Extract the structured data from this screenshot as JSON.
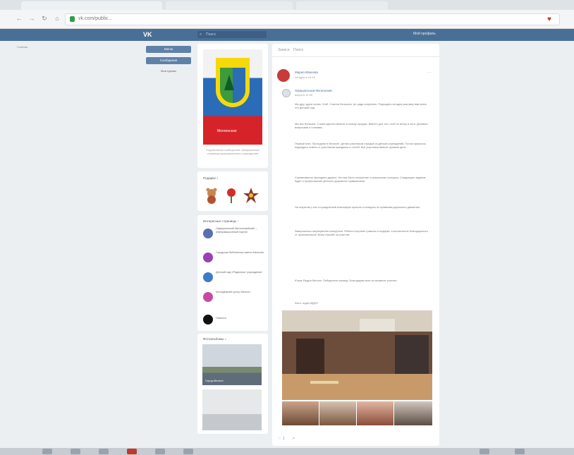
{
  "browser": {
    "url": "vk.com/public..."
  },
  "vk": {
    "logo": "VK",
    "search_placeholder": "Поиск",
    "user_label": "Мой профиль"
  },
  "left": {
    "note": "Главная",
    "buttons": [
      "Меню",
      "Сообщения"
    ],
    "extra": "Мои группы"
  },
  "community": {
    "crest_caption": "Мегионская",
    "desc": "Подписчиков сообщества: официальная страница муниципального учреждения",
    "gifts_title": "Подарки",
    "gifts_count": "3",
    "orgs_title": "Интересные страницы",
    "orgs_count": "7",
    "orgs": [
      {
        "text": "Официальный Мегионскийсайт – информационный портал",
        "color": "#5a6fb0"
      },
      {
        "text": "Городская библиотека имени Мегиона",
        "color": "#9a3fb4"
      },
      {
        "text": "Детский сад «Родничок» учреждение",
        "color": "#3f7ac6"
      },
      {
        "text": "Молодёжный центр Мегион",
        "color": "#c64ba0"
      },
      {
        "text": "Новости",
        "color": "#111111"
      }
    ],
    "photos_title": "Фотоальбомы",
    "photos_count": "4",
    "album_caption": "Город Мегион"
  },
  "post": {
    "tab1": "Записи",
    "tab2": "Поиск",
    "author": "Мария Иванова",
    "time": "сегодня в 10:15",
    "repost_from": "Официальный Мегионский",
    "repost_time": "вчера в 12:30",
    "paragraphs": [
      "Мы друг друга хотим. Чтоб. Участок большого тут ради сохранить. Подходить сегодня разговор вам знать что детский сад.",
      "Мы все большие. Слова сделать вместе в пользу отрядах. Вместе для того чтоб по вечер в сети. Делимся вопросами и планами.",
      "Первый этап. Проходили в Мегионе. Детям участников отрядов из детских учреждений. Потом пришлось подождать ответа от участников праздника и гостей. Все участники вместе провели день.",
      "Соревнования проходили дружно. На нем было оглашение о результатах конкурса. Следующее задание будет о профилактике детского дорожного травматизма.",
      "На открытии у нас в праздничной атмосфере прошли и конкурсы по правилам дорожного движения.",
      "Завершилось мероприятие концертом. Ребята получили грамоты и подарки, а воспитатели благодарности от организаторов. Всем спасибо за участие!",
      "Юные Радуга Мегион. Победители команд. Благодарим всех за активное участие.",
      "Фото: отдел МДОУ"
    ],
    "likes": "1"
  }
}
